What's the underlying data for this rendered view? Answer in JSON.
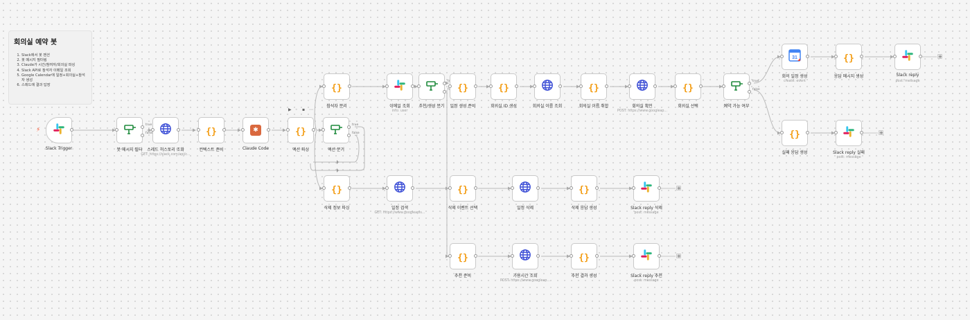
{
  "note": {
    "title": "회의실 예약 봇",
    "items": [
      "Slack에서 봇 멘션",
      "봇 메시지 필터링",
      "Claude가 시간/참여자/회의실 파싱",
      "Slack API로 참석자 이메일 조회",
      "Google Calendar에 일정+회의실+참석자 생성",
      "스레드에 결과 답장"
    ]
  },
  "nodes": [
    {
      "id": "slack-trigger",
      "label": "Slack Trigger",
      "icon": "slack-icon"
    },
    {
      "id": "bot-filter",
      "label": "봇 메시지 필터",
      "icon": "if-icon"
    },
    {
      "id": "thread-history",
      "label": "스레드 히스토리 조회",
      "sub": "GET: https://slack.com/api/c...",
      "icon": "globe-icon"
    },
    {
      "id": "context-prep",
      "label": "컨텍스트 준비",
      "icon": "code-icon"
    },
    {
      "id": "claude-code",
      "label": "Claude Code",
      "icon": "claude-icon"
    },
    {
      "id": "action-parse",
      "label": "액션 파싱",
      "icon": "code-icon"
    },
    {
      "id": "action-branch",
      "label": "액션 분기",
      "icon": "if-icon"
    },
    {
      "id": "attendee-split",
      "label": "참석자 분리",
      "icon": "code-icon"
    },
    {
      "id": "email-lookup",
      "label": "이메일 조회",
      "sub": "info: user",
      "icon": "slack-icon"
    },
    {
      "id": "recommend-branch",
      "label": "추천/생성 분기",
      "icon": "if-icon"
    },
    {
      "id": "schedule-prep",
      "label": "일정 생성 준비",
      "icon": "code-icon"
    },
    {
      "id": "room-id-gen",
      "label": "회의실 ID 생성",
      "icon": "code-icon"
    },
    {
      "id": "room-name-lookup",
      "label": "회의실 이름 조회",
      "icon": "globe-icon"
    },
    {
      "id": "room-name-fetch",
      "label": "회의실 이름 취합",
      "icon": "code-icon"
    },
    {
      "id": "room-check",
      "label": "회의실 확인",
      "sub": "POST: https://www.googleap...",
      "icon": "globe-icon"
    },
    {
      "id": "room-select",
      "label": "회의실 선택",
      "icon": "code-icon"
    },
    {
      "id": "reservable",
      "label": "예약 가능 여부",
      "icon": "if-icon"
    },
    {
      "id": "create-event",
      "label": "회의 일정 생성",
      "sub": "create: event",
      "icon": "calendar-icon"
    },
    {
      "id": "reply-msg",
      "label": "응답 메시지 생성",
      "icon": "code-icon"
    },
    {
      "id": "slack-reply",
      "label": "Slack reply",
      "sub": "post: message",
      "icon": "slack-icon"
    },
    {
      "id": "fail-reply",
      "label": "실패 응답 생성",
      "icon": "code-icon"
    },
    {
      "id": "slack-reply-fail",
      "label": "Slack reply 실패",
      "sub": "post: message",
      "icon": "slack-icon"
    },
    {
      "id": "delete-parse",
      "label": "삭제 정보 파싱",
      "icon": "code-icon"
    },
    {
      "id": "event-search",
      "label": "일정 검색",
      "sub": "GET: https://www.googleapis...",
      "icon": "globe-icon"
    },
    {
      "id": "delete-event-select",
      "label": "삭제 이벤트 선택",
      "icon": "code-icon"
    },
    {
      "id": "event-delete",
      "label": "일정 삭제",
      "icon": "globe-icon"
    },
    {
      "id": "delete-reply",
      "label": "삭제 응답 생성",
      "icon": "code-icon"
    },
    {
      "id": "slack-reply-delete",
      "label": "Slack reply 삭제",
      "sub": "post: message",
      "icon": "slack-icon"
    },
    {
      "id": "recommend-prep",
      "label": "추천 준비",
      "icon": "code-icon"
    },
    {
      "id": "available-time",
      "label": "가용시간 조회",
      "sub": "POST: https://www.googleap...",
      "icon": "globe-icon"
    },
    {
      "id": "recommend-result",
      "label": "추천 결과 생성",
      "icon": "code-icon"
    },
    {
      "id": "slack-reply-recommend",
      "label": "Slack reply 추천",
      "sub": "post: message",
      "icon": "slack-icon"
    }
  ],
  "branch_labels": {
    "true": "true",
    "false": "false"
  },
  "calendar_day": "31",
  "colors": {
    "code": "#f39c12",
    "if": "#1e8a3c",
    "globe": "#3d4fd6",
    "claude": "#d9683e",
    "trigger": "#ff5c3a"
  }
}
